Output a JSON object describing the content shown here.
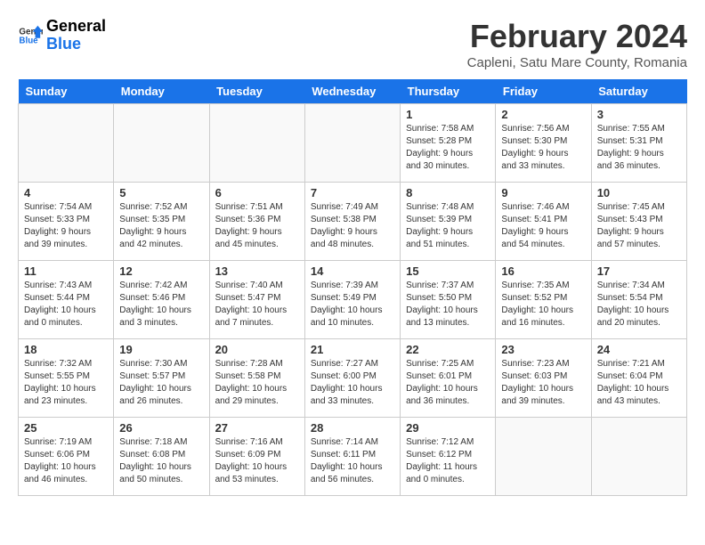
{
  "header": {
    "logo_text_general": "General",
    "logo_text_blue": "Blue",
    "month_year": "February 2024",
    "location": "Capleni, Satu Mare County, Romania"
  },
  "calendar": {
    "days_of_week": [
      "Sunday",
      "Monday",
      "Tuesday",
      "Wednesday",
      "Thursday",
      "Friday",
      "Saturday"
    ],
    "weeks": [
      [
        {
          "day": "",
          "info": ""
        },
        {
          "day": "",
          "info": ""
        },
        {
          "day": "",
          "info": ""
        },
        {
          "day": "",
          "info": ""
        },
        {
          "day": "1",
          "info": "Sunrise: 7:58 AM\nSunset: 5:28 PM\nDaylight: 9 hours and 30 minutes."
        },
        {
          "day": "2",
          "info": "Sunrise: 7:56 AM\nSunset: 5:30 PM\nDaylight: 9 hours and 33 minutes."
        },
        {
          "day": "3",
          "info": "Sunrise: 7:55 AM\nSunset: 5:31 PM\nDaylight: 9 hours and 36 minutes."
        }
      ],
      [
        {
          "day": "4",
          "info": "Sunrise: 7:54 AM\nSunset: 5:33 PM\nDaylight: 9 hours and 39 minutes."
        },
        {
          "day": "5",
          "info": "Sunrise: 7:52 AM\nSunset: 5:35 PM\nDaylight: 9 hours and 42 minutes."
        },
        {
          "day": "6",
          "info": "Sunrise: 7:51 AM\nSunset: 5:36 PM\nDaylight: 9 hours and 45 minutes."
        },
        {
          "day": "7",
          "info": "Sunrise: 7:49 AM\nSunset: 5:38 PM\nDaylight: 9 hours and 48 minutes."
        },
        {
          "day": "8",
          "info": "Sunrise: 7:48 AM\nSunset: 5:39 PM\nDaylight: 9 hours and 51 minutes."
        },
        {
          "day": "9",
          "info": "Sunrise: 7:46 AM\nSunset: 5:41 PM\nDaylight: 9 hours and 54 minutes."
        },
        {
          "day": "10",
          "info": "Sunrise: 7:45 AM\nSunset: 5:43 PM\nDaylight: 9 hours and 57 minutes."
        }
      ],
      [
        {
          "day": "11",
          "info": "Sunrise: 7:43 AM\nSunset: 5:44 PM\nDaylight: 10 hours and 0 minutes."
        },
        {
          "day": "12",
          "info": "Sunrise: 7:42 AM\nSunset: 5:46 PM\nDaylight: 10 hours and 3 minutes."
        },
        {
          "day": "13",
          "info": "Sunrise: 7:40 AM\nSunset: 5:47 PM\nDaylight: 10 hours and 7 minutes."
        },
        {
          "day": "14",
          "info": "Sunrise: 7:39 AM\nSunset: 5:49 PM\nDaylight: 10 hours and 10 minutes."
        },
        {
          "day": "15",
          "info": "Sunrise: 7:37 AM\nSunset: 5:50 PM\nDaylight: 10 hours and 13 minutes."
        },
        {
          "day": "16",
          "info": "Sunrise: 7:35 AM\nSunset: 5:52 PM\nDaylight: 10 hours and 16 minutes."
        },
        {
          "day": "17",
          "info": "Sunrise: 7:34 AM\nSunset: 5:54 PM\nDaylight: 10 hours and 20 minutes."
        }
      ],
      [
        {
          "day": "18",
          "info": "Sunrise: 7:32 AM\nSunset: 5:55 PM\nDaylight: 10 hours and 23 minutes."
        },
        {
          "day": "19",
          "info": "Sunrise: 7:30 AM\nSunset: 5:57 PM\nDaylight: 10 hours and 26 minutes."
        },
        {
          "day": "20",
          "info": "Sunrise: 7:28 AM\nSunset: 5:58 PM\nDaylight: 10 hours and 29 minutes."
        },
        {
          "day": "21",
          "info": "Sunrise: 7:27 AM\nSunset: 6:00 PM\nDaylight: 10 hours and 33 minutes."
        },
        {
          "day": "22",
          "info": "Sunrise: 7:25 AM\nSunset: 6:01 PM\nDaylight: 10 hours and 36 minutes."
        },
        {
          "day": "23",
          "info": "Sunrise: 7:23 AM\nSunset: 6:03 PM\nDaylight: 10 hours and 39 minutes."
        },
        {
          "day": "24",
          "info": "Sunrise: 7:21 AM\nSunset: 6:04 PM\nDaylight: 10 hours and 43 minutes."
        }
      ],
      [
        {
          "day": "25",
          "info": "Sunrise: 7:19 AM\nSunset: 6:06 PM\nDaylight: 10 hours and 46 minutes."
        },
        {
          "day": "26",
          "info": "Sunrise: 7:18 AM\nSunset: 6:08 PM\nDaylight: 10 hours and 50 minutes."
        },
        {
          "day": "27",
          "info": "Sunrise: 7:16 AM\nSunset: 6:09 PM\nDaylight: 10 hours and 53 minutes."
        },
        {
          "day": "28",
          "info": "Sunrise: 7:14 AM\nSunset: 6:11 PM\nDaylight: 10 hours and 56 minutes."
        },
        {
          "day": "29",
          "info": "Sunrise: 7:12 AM\nSunset: 6:12 PM\nDaylight: 11 hours and 0 minutes."
        },
        {
          "day": "",
          "info": ""
        },
        {
          "day": "",
          "info": ""
        }
      ]
    ]
  }
}
